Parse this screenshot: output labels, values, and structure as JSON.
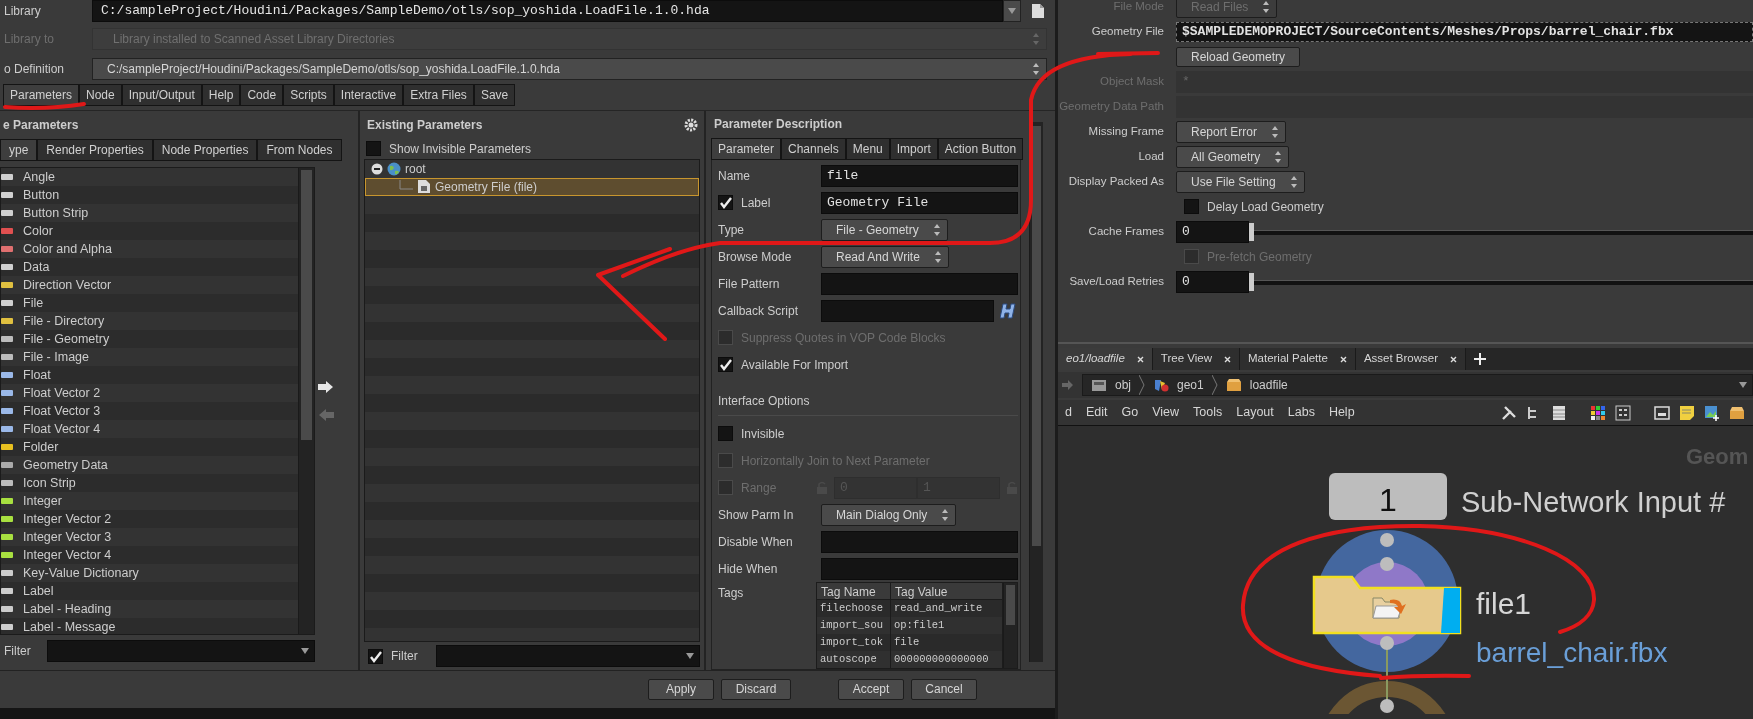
{
  "library_rows": [
    {
      "kind": "path",
      "label": "Library",
      "value": "C:/sampleProject/Houdini/Packages/SampleDemo/otls/sop_yoshida.LoadFile.1.0.hda"
    },
    {
      "kind": "disabled",
      "label": "Library to",
      "value": "Library installed to Scanned Asset Library Directories"
    },
    {
      "kind": "select",
      "label": "o Definition",
      "value": "C:/sampleProject/Houdini/Packages/SampleDemo/otls/sop_yoshida.LoadFile.1.0.hda"
    }
  ],
  "main_tabs": [
    {
      "label": "Parameters",
      "selected": true
    },
    {
      "label": "Node",
      "selected": false
    },
    {
      "label": "Input/Output",
      "selected": false
    },
    {
      "label": "Help",
      "selected": false
    },
    {
      "label": "Code",
      "selected": false
    },
    {
      "label": "Scripts",
      "selected": false
    },
    {
      "label": "Interactive",
      "selected": false
    },
    {
      "label": "Extra Files",
      "selected": false
    },
    {
      "label": "Save",
      "selected": false
    }
  ],
  "create_parameters": {
    "title": "e Parameters",
    "tabs": [
      {
        "label": "ype",
        "selected": true
      },
      {
        "label": "Render Properties",
        "selected": false
      },
      {
        "label": "Node Properties",
        "selected": false
      },
      {
        "label": "From Nodes",
        "selected": false
      }
    ],
    "items": [
      "Angle",
      "Button",
      "Button Strip",
      "Color",
      "Color and Alpha",
      "Data",
      "Direction Vector",
      "File",
      "File - Directory",
      "File - Geometry",
      "File - Image",
      "Float",
      "Float Vector 2",
      "Float Vector 3",
      "Float Vector 4",
      "Folder",
      "Geometry Data",
      "Icon Strip",
      "Integer",
      "Integer Vector 2",
      "Integer Vector 3",
      "Integer Vector 4",
      "Key-Value Dictionary",
      "Label",
      "Label - Heading",
      "Label - Message"
    ],
    "filter_label": "Filter"
  },
  "existing_parameters": {
    "title": "Existing Parameters",
    "show_invisible": {
      "label": "Show Invisible Parameters",
      "checked": false
    },
    "tree": [
      {
        "label": "root",
        "expanded": true,
        "selected": false,
        "children": [
          {
            "label": "Geometry File (file)",
            "selected": true
          }
        ]
      }
    ],
    "filter": {
      "label": "Filter",
      "checked": true
    }
  },
  "parameter_description": {
    "title": "Parameter Description",
    "tabs": [
      {
        "label": "Parameter",
        "selected": true
      },
      {
        "label": "Channels",
        "selected": false
      },
      {
        "label": "Menu",
        "selected": false
      },
      {
        "label": "Import",
        "selected": false
      },
      {
        "label": "Action Button",
        "selected": false
      }
    ],
    "rows": [
      {
        "kind": "field",
        "label": "Name",
        "value": "file"
      },
      {
        "kind": "check_field",
        "label": "Label",
        "checked": true,
        "value": "Geometry File"
      },
      {
        "kind": "select",
        "label": "Type",
        "value": "File - Geometry"
      },
      {
        "kind": "select",
        "label": "Browse Mode",
        "value": "Read And Write"
      },
      {
        "kind": "field",
        "label": "File Pattern"
      },
      {
        "kind": "script",
        "label": "Callback Script"
      },
      {
        "kind": "checkbox",
        "label": "Suppress Quotes in VOP Code Blocks",
        "checked": false,
        "disabled": true
      },
      {
        "kind": "checkbox",
        "label": "Available For Import",
        "checked": true,
        "disabled": false
      },
      {
        "kind": "heading",
        "label": "Interface Options"
      },
      {
        "kind": "checkbox",
        "label": "Invisible",
        "checked": false,
        "disabled": false
      },
      {
        "kind": "checkbox",
        "label": "Horizontally Join to Next Parameter",
        "checked": false,
        "disabled": true
      },
      {
        "kind": "range",
        "label": "Range",
        "checked": false,
        "disabled": true,
        "min": "0",
        "max": "1"
      },
      {
        "kind": "select",
        "label": "Show Parm In",
        "value": "Main Dialog Only"
      },
      {
        "kind": "field",
        "label": "Disable When"
      },
      {
        "kind": "field",
        "label": "Hide When"
      },
      {
        "kind": "tags",
        "label": "Tags",
        "columns": [
          "Tag Name",
          "Tag Value"
        ],
        "rows": [
          [
            "filechoose",
            "read_and_write"
          ],
          [
            "import_sou",
            "op:file1"
          ],
          [
            "import_tok",
            "file"
          ],
          [
            "autoscope",
            "000000000000000"
          ]
        ]
      }
    ]
  },
  "dialog_buttons": [
    "Apply",
    "Discard",
    "Accept",
    "Cancel"
  ],
  "node_parameters": [
    {
      "kind": "select",
      "label": "File Mode",
      "value": "Read Files",
      "disabled": true
    },
    {
      "kind": "file",
      "label": "Geometry File",
      "value": "$SAMPLEDEMOPROJECT/SourceContents/Meshes/Props/barrel_chair.fbx"
    },
    {
      "kind": "button",
      "label": "Reload Geometry"
    },
    {
      "kind": "text",
      "label": "Object Mask",
      "value": "*",
      "disabled": true
    },
    {
      "kind": "text",
      "label": "Geometry Data Path",
      "disabled": true
    },
    {
      "kind": "select",
      "label": "Missing Frame",
      "value": "Report Error",
      "disabled": false
    },
    {
      "kind": "select",
      "label": "Load",
      "value": "All Geometry",
      "disabled": false
    },
    {
      "kind": "select",
      "label": "Display Packed As",
      "value": "Use File Setting",
      "disabled": false
    },
    {
      "kind": "checkbox",
      "label": "Delay Load Geometry",
      "checked": false,
      "disabled": false
    },
    {
      "kind": "slider",
      "label": "Cache Frames",
      "value": "0",
      "level": 0
    },
    {
      "kind": "checkbox",
      "label": "Pre-fetch Geometry",
      "checked": false,
      "disabled": true
    },
    {
      "kind": "slider",
      "label": "Save/Load Retries",
      "value": "0",
      "level": 0
    }
  ],
  "pane_tabs": [
    {
      "label": "eo1/loadfile",
      "selected": true
    },
    {
      "label": "Tree View",
      "selected": false
    },
    {
      "label": "Material Palette",
      "selected": false
    },
    {
      "label": "Asset Browser",
      "selected": false
    }
  ],
  "path": [
    "obj",
    "geo1",
    "loadfile"
  ],
  "menu": [
    "d",
    "Edit",
    "Go",
    "View",
    "Tools",
    "Layout",
    "Labs",
    "Help"
  ],
  "network": {
    "context_label": "Geom",
    "input_node": {
      "number": "1",
      "label": "Sub-Network Input #"
    },
    "node": {
      "name": "file1",
      "comment": "barrel_chair.fbx",
      "selected": true,
      "display_flag": true
    }
  }
}
